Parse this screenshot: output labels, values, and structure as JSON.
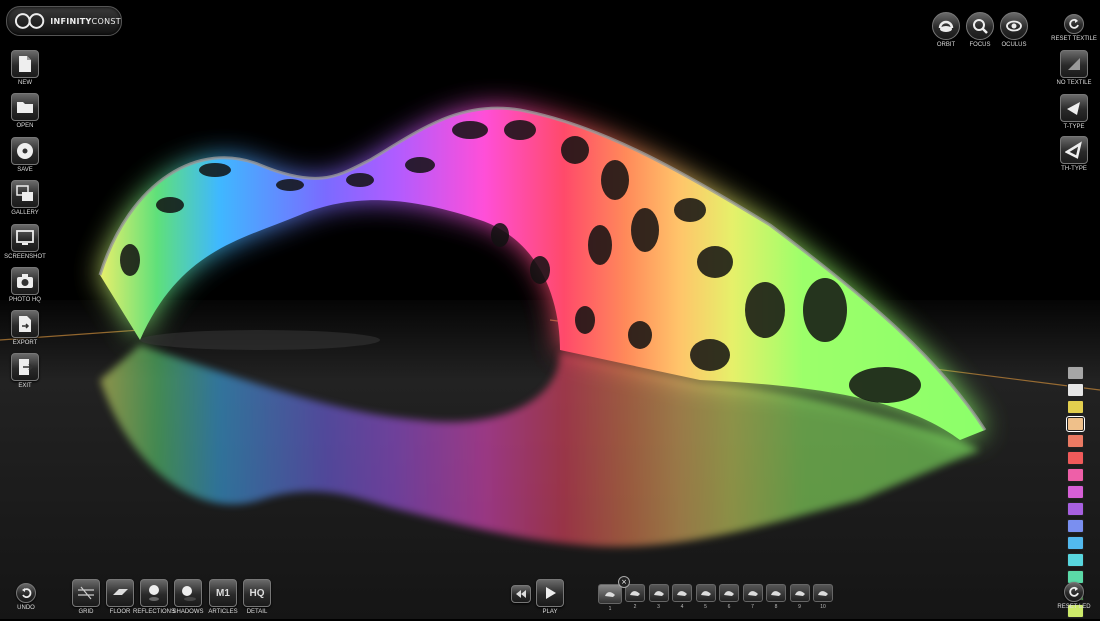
{
  "app": {
    "logo_part1": "INFINITY",
    "logo_part2": "CONST"
  },
  "left_toolbar": [
    {
      "id": "new",
      "label": "NEW",
      "icon": "new-document-icon"
    },
    {
      "id": "open",
      "label": "OPEN",
      "icon": "folder-icon"
    },
    {
      "id": "save",
      "label": "SAVE",
      "icon": "disc-icon"
    },
    {
      "id": "gallery",
      "label": "GALLERY",
      "icon": "gallery-icon"
    },
    {
      "id": "screenshot",
      "label": "SCREENSHOT",
      "icon": "monitor-icon"
    },
    {
      "id": "photohq",
      "label": "PHOTO HQ",
      "icon": "camera-icon"
    },
    {
      "id": "export",
      "label": "EXPORT",
      "icon": "export-icon"
    },
    {
      "id": "exit",
      "label": "EXIT",
      "icon": "exit-icon"
    }
  ],
  "top_toolbar": [
    {
      "id": "orbit",
      "label": "ORBIT",
      "icon": "orbit-icon"
    },
    {
      "id": "focus",
      "label": "FOCUS",
      "icon": "magnifier-icon"
    },
    {
      "id": "oculus",
      "label": "OCULUS",
      "icon": "eye-icon"
    }
  ],
  "right_toolbar": {
    "reset_textile": "RESET TEXTILE",
    "no_textile": "NO TEXTILE",
    "t_type": "T-TYPE",
    "th_type": "TH-TYPE",
    "reset_led": "RESET LED"
  },
  "bottom_toolbar": {
    "undo": "UNDO",
    "grid": "GRID",
    "floor": "FLOOR",
    "reflections": "REFLECTIONS",
    "shadows": "SHADOWS",
    "articles": "ARTICLES",
    "articles_icon_text": "M1",
    "detail": "DETAIL",
    "detail_icon_text": "HQ",
    "play": "PLAY"
  },
  "frames": [
    "1",
    "2",
    "3",
    "4",
    "5",
    "6",
    "7",
    "8",
    "9",
    "10"
  ],
  "close_glyph": "×",
  "led_colors": [
    "#a6a6a6",
    "#e6e6e6",
    "#e3cf4e",
    "#efc08a",
    "#ea7a63",
    "#f05a5a",
    "#ee5fa8",
    "#d65fd6",
    "#a760e0",
    "#7a8ff0",
    "#52b9ee",
    "#58d6de",
    "#5bd9a7",
    "#7be27a",
    "#cdea6a"
  ],
  "selected_led_index": 3
}
